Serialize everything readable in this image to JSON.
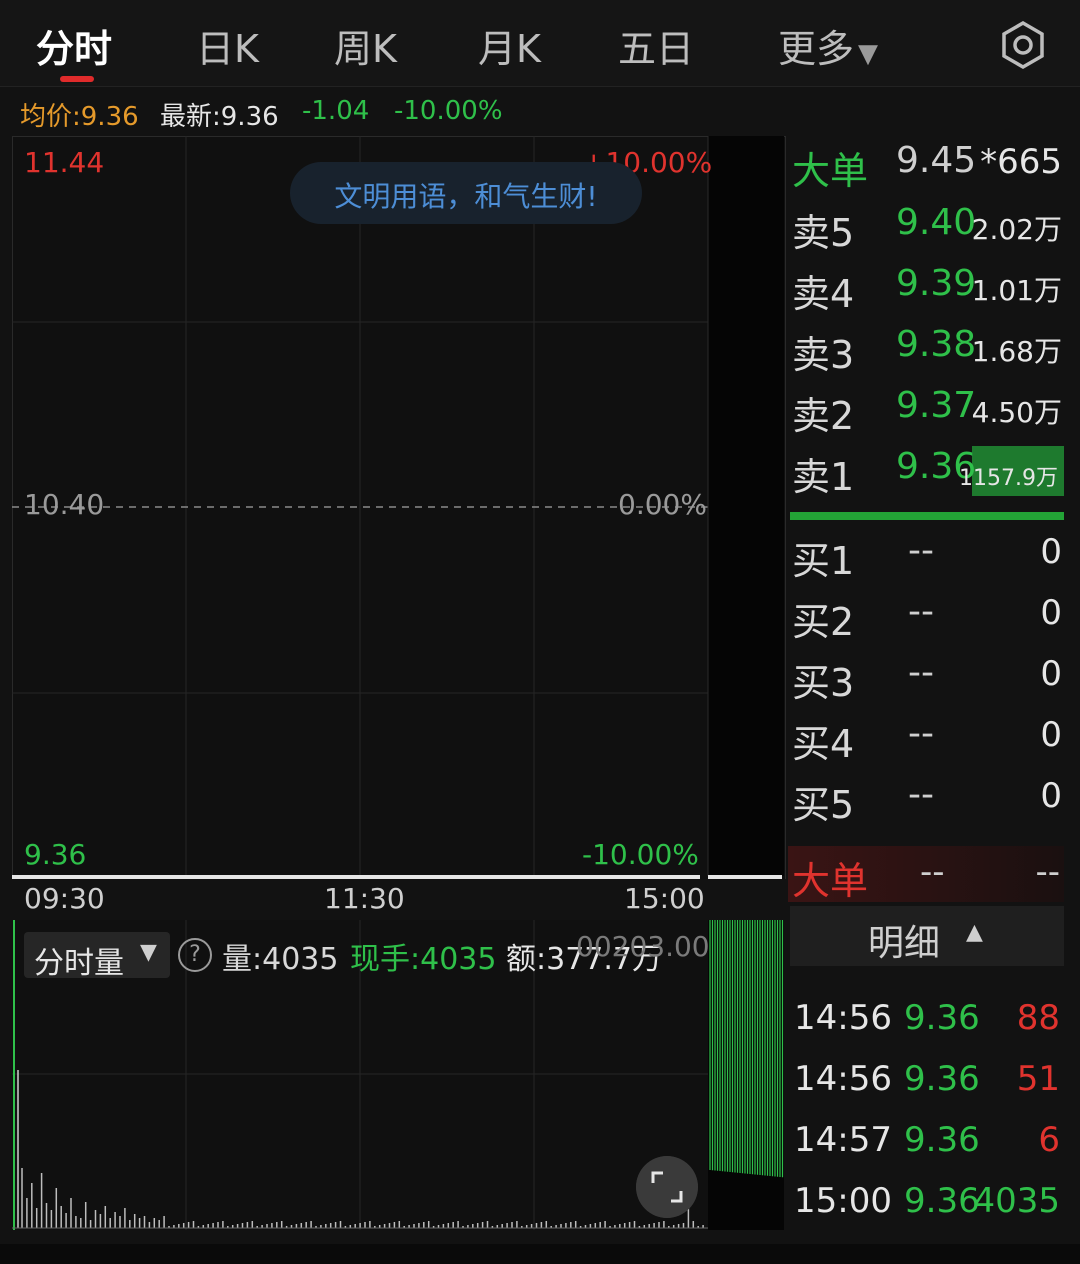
{
  "tabs": [
    {
      "label": "分时",
      "active": true
    },
    {
      "label": "日K"
    },
    {
      "label": "周K"
    },
    {
      "label": "月K"
    },
    {
      "label": "五日"
    },
    {
      "label": "更多",
      "dropdown": true
    }
  ],
  "settings_icon": "gear-icon",
  "info_row": {
    "avg": "均价:9.36",
    "latest": "最新:9.36",
    "change": "-1.04",
    "change_pct": "-10.00%"
  },
  "chart": {
    "y_high": "11.44",
    "y_high_pct": "+10.00%",
    "y_mid": "10.40",
    "y_mid_pct": "0.00%",
    "y_low": "9.36",
    "y_low_pct": "-10.00%",
    "notice": "文明用语，和气生财!",
    "time_labels": [
      "09:30",
      "11:30",
      "15:00"
    ]
  },
  "volume_panel": {
    "selector": "分时量",
    "volume": "量:4035",
    "current_hand": "现手:4035",
    "amount": "额:377.7万",
    "overlay": "00203.00"
  },
  "order_book": {
    "big_top": {
      "name": "大单",
      "price": "9.45",
      "vol": "*665"
    },
    "sells": [
      {
        "name": "卖5",
        "price": "9.40",
        "vol": "2.02万"
      },
      {
        "name": "卖4",
        "price": "9.39",
        "vol": "1.01万"
      },
      {
        "name": "卖3",
        "price": "9.38",
        "vol": "1.68万"
      },
      {
        "name": "卖2",
        "price": "9.37",
        "vol": "4.50万"
      },
      {
        "name": "卖1",
        "price": "9.36",
        "vol": "1157.9万"
      }
    ],
    "buys": [
      {
        "name": "买1",
        "price": "--",
        "vol": "0"
      },
      {
        "name": "买2",
        "price": "--",
        "vol": "0"
      },
      {
        "name": "买3",
        "price": "--",
        "vol": "0"
      },
      {
        "name": "买4",
        "price": "--",
        "vol": "0"
      },
      {
        "name": "买5",
        "price": "--",
        "vol": "0"
      }
    ],
    "big_bottom": {
      "name": "大单",
      "price": "--",
      "vol": "--"
    }
  },
  "detail": {
    "title": "明细",
    "trades": [
      {
        "time": "14:56",
        "price": "9.36",
        "vol": "88",
        "side": "buy"
      },
      {
        "time": "14:56",
        "price": "9.36",
        "vol": "51",
        "side": "buy"
      },
      {
        "time": "14:57",
        "price": "9.36",
        "vol": "6",
        "side": "buy"
      },
      {
        "time": "15:00",
        "price": "9.36",
        "vol": "4035",
        "side": "sell"
      }
    ]
  },
  "colors": {
    "up": "#e0332e",
    "down": "#2fc04a",
    "avg": "#e59a2b",
    "notice": "#4d8ed6"
  }
}
